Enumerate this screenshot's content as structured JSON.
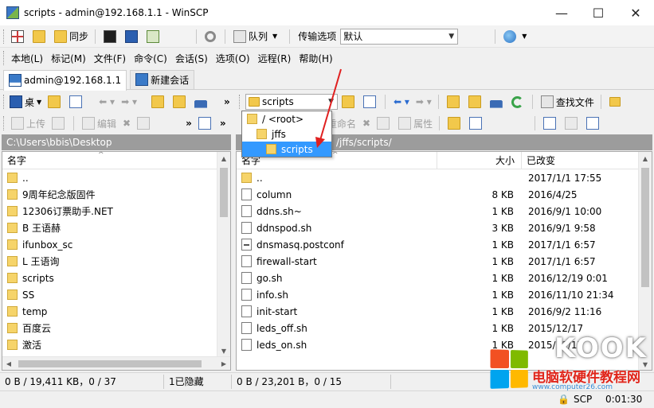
{
  "window": {
    "title": "scripts - admin@192.168.1.1 - WinSCP",
    "minimize": "—",
    "maximize": "☐",
    "close": "✕"
  },
  "toolbar": {
    "sync": "同步",
    "queue": "队列",
    "transfer_options_label": "传输选项",
    "transfer_options_value": "默认"
  },
  "menu": {
    "items": [
      "本地(L)",
      "标记(M)",
      "文件(F)",
      "命令(C)",
      "会话(S)",
      "选项(O)",
      "远程(R)",
      "帮助(H)"
    ]
  },
  "tabs": {
    "session": "admin@192.168.1.1",
    "new_session": "新建会话"
  },
  "local": {
    "drive_label": "桌",
    "upload": "上传",
    "edit": "编辑",
    "path": "C:\\Users\\bbis\\Desktop",
    "col_name": "名字",
    "files": [
      {
        "name": "..",
        "type": "up"
      },
      {
        "name": "9周年纪念版固件",
        "type": "folder"
      },
      {
        "name": "12306订票助手.NET",
        "type": "folder"
      },
      {
        "name": "B 王语赫",
        "type": "folder"
      },
      {
        "name": "ifunbox_sc",
        "type": "folder"
      },
      {
        "name": "L 王语询",
        "type": "folder"
      },
      {
        "name": "scripts",
        "type": "folder"
      },
      {
        "name": "SS",
        "type": "folder"
      },
      {
        "name": "temp",
        "type": "folder"
      },
      {
        "name": "百度云",
        "type": "folder"
      },
      {
        "name": "激活",
        "type": "folder"
      }
    ],
    "status_size": "0 B / 19,411 KB，0 / 37",
    "status_hidden": "1已隐藏"
  },
  "remote": {
    "dir_select": "scripts",
    "find_files": "查找文件",
    "rename": "重命名",
    "properties": "属性",
    "path": "/jffs/scripts/",
    "col_name": "名字",
    "col_size": "大小",
    "col_changed": "已改变",
    "files": [
      {
        "name": "..",
        "size": "",
        "date": "2017/1/1 17:55",
        "type": "up"
      },
      {
        "name": "column",
        "size": "8 KB",
        "date": "2016/4/25",
        "type": "file"
      },
      {
        "name": "ddns.sh~",
        "size": "1 KB",
        "date": "2016/9/1 10:00",
        "type": "file"
      },
      {
        "name": "ddnspod.sh",
        "size": "3 KB",
        "date": "2016/9/1 9:58",
        "type": "file"
      },
      {
        "name": "dnsmasq.postconf",
        "size": "1 KB",
        "date": "2017/1/1 6:57",
        "type": "bin"
      },
      {
        "name": "firewall-start",
        "size": "1 KB",
        "date": "2017/1/1 6:57",
        "type": "file"
      },
      {
        "name": "go.sh",
        "size": "1 KB",
        "date": "2016/12/19 0:01",
        "type": "file"
      },
      {
        "name": "info.sh",
        "size": "1 KB",
        "date": "2016/11/10 21:34",
        "type": "file"
      },
      {
        "name": "init-start",
        "size": "1 KB",
        "date": "2016/9/2 11:16",
        "type": "file"
      },
      {
        "name": "leds_off.sh",
        "size": "1 KB",
        "date": "2015/12/17",
        "type": "file"
      },
      {
        "name": "leds_on.sh",
        "size": "1 KB",
        "date": "2015/12/17",
        "type": "file"
      }
    ],
    "status_size": "0 B / 23,201 B，0 / 15"
  },
  "dropdown": {
    "items": [
      {
        "label": "/ <root>",
        "indent": 0,
        "selected": false
      },
      {
        "label": "jffs",
        "indent": 1,
        "selected": false
      },
      {
        "label": "scripts",
        "indent": 2,
        "selected": true
      }
    ]
  },
  "statusbar": {
    "protocol": "SCP",
    "timer": "0:01:30"
  },
  "watermark": {
    "brand": "KOOK",
    "site_name": "电脑软硬件教程网",
    "site_url": "www.computer26.com"
  },
  "colors": {
    "selection": "#3399ff",
    "pane_header": "#9c9c9c",
    "arrow_annotation": "#e02020",
    "folder": "#f6d46a"
  }
}
